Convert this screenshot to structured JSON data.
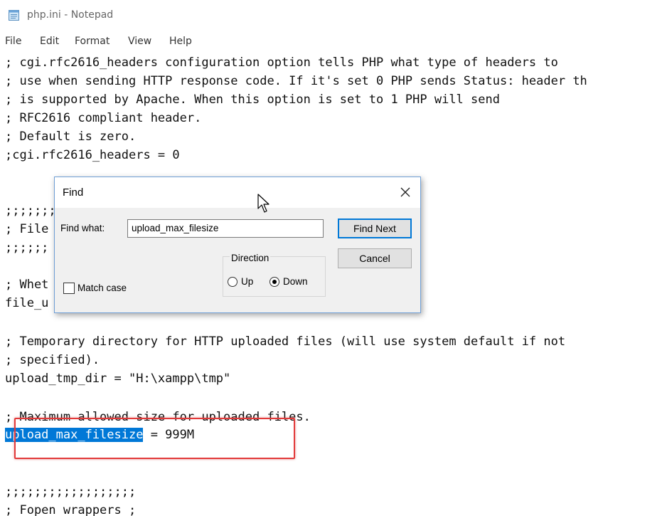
{
  "window": {
    "title": "php.ini - Notepad",
    "app_icon": "notepad-icon"
  },
  "menu": [
    "File",
    "Edit",
    "Format",
    "View",
    "Help"
  ],
  "editor": {
    "lines": [
      "; cgi.rfc2616_headers configuration option tells PHP what type of headers to",
      "; use when sending HTTP response code. If it's set 0 PHP sends Status: header th",
      "; is supported by Apache. When this option is set to 1 PHP will send",
      "; RFC2616 compliant header.",
      "; Default is zero.",
      ";cgi.rfc2616_headers = 0",
      "",
      "",
      ";;;;;;;",
      "; File",
      ";;;;;;",
      "",
      "; Whet",
      "file_u",
      "",
      "; Temporary directory for HTTP uploaded files (will use system default if not",
      "; specified).",
      "upload_tmp_dir = \"H:\\xampp\\tmp\"",
      "",
      "; Maximum allowed size for uploaded files.",
      "",
      "",
      "",
      ";;;;;;;;;;;;;;;;;;",
      "; Fopen wrappers ;"
    ],
    "selected_text": "upload_max_filesize",
    "selected_line_rest": " = 999M"
  },
  "find_dialog": {
    "title": "Find",
    "find_what_label": "Find what:",
    "find_what_value": "upload_max_filesize",
    "find_next_label": "Find Next",
    "cancel_label": "Cancel",
    "direction_label": "Direction",
    "up_label": "Up",
    "down_label": "Down",
    "direction_selected": "Down",
    "match_case_label": "Match case",
    "match_case_checked": false
  },
  "colors": {
    "selection": "#0078d7",
    "highlight_box": "#e23a3a",
    "dialog_border": "#6f9fd6"
  }
}
